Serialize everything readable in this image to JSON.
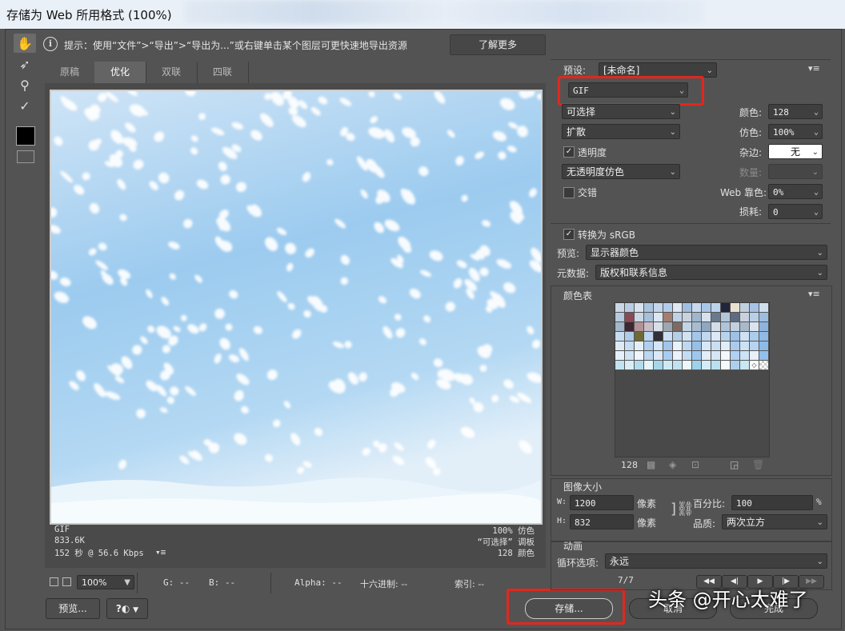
{
  "window": {
    "title": "存储为 Web 所用格式 (100%)"
  },
  "info": {
    "text": "提示：使用“文件”>“导出”>“导出为...”或右键单击某个图层可更快速地导出资源",
    "learn_more": "了解更多"
  },
  "tabs": [
    "原稿",
    "优化",
    "双联",
    "四联"
  ],
  "preview_info": {
    "format": "GIF",
    "size": "833.6K",
    "time": "152 秒 @ 56.6 Kbps",
    "dither": "100% 仿色",
    "palette": "“可选择” 调板",
    "colors": "128 颜色"
  },
  "status": {
    "zoom": "100%",
    "r": "G: --",
    "b": "B: --",
    "alpha": "Alpha: --",
    "hex": "十六进制: --",
    "index": "索引: --"
  },
  "buttons": {
    "preview": "预览...",
    "save": "存储...",
    "cancel": "取消",
    "done": "完成"
  },
  "settings": {
    "preset_label": "预设:",
    "preset_value": "[未命名]",
    "format": "GIF",
    "reduction": "可选择",
    "dither_algo": "扩散",
    "transparency_label": "透明度",
    "transparency_checked": true,
    "trans_dither": "无透明度仿色",
    "interlaced_label": "交错",
    "interlaced_checked": false,
    "colors_label": "颜色:",
    "colors_value": "128",
    "dither_label": "仿色:",
    "dither_value": "100%",
    "matte_label": "杂边:",
    "matte_value": "无",
    "amount_label": "数量:",
    "amount_value": "",
    "websnap_label": "Web 靠色:",
    "websnap_value": "0%",
    "lossy_label": "损耗:",
    "lossy_value": "0",
    "srgb_label": "转换为 sRGB",
    "srgb_checked": true,
    "preview_label": "预览:",
    "preview_value": "显示器颜色",
    "metadata_label": "元数据:",
    "metadata_value": "版权和联系信息"
  },
  "color_table": {
    "title": "颜色表",
    "count": "128",
    "colors": [
      "#c9d7e6",
      "#b9cde2",
      "#d9e3ee",
      "#aac4df",
      "#c3d6ec",
      "#b3ccea",
      "#dfe7f0",
      "#9fbfe2",
      "#c8d9ee",
      "#a9c7e8",
      "#bcd3ec",
      "#22253a",
      "#e8e1d2",
      "#c1d0e0",
      "#a6c3e4",
      "#d0deec",
      "#b7c9dc",
      "#8a4a55",
      "#cad7e4",
      "#a7bfd8",
      "#dce6f1",
      "#a47e70",
      "#bfd2e8",
      "#c9d3dd",
      "#9fb6cc",
      "#d6e1ed",
      "#697a8d",
      "#b3c7db",
      "#5f6b80",
      "#c7d2de",
      "#b9cfe8",
      "#9cbde0",
      "#a3b7cb",
      "#3b2832",
      "#b29296",
      "#c8bcc6",
      "#d7dfe9",
      "#9fa5b1",
      "#7e6a64",
      "#c4d4e5",
      "#a8bcd1",
      "#8fa7c0",
      "#d3dde8",
      "#b0c5da",
      "#c1cfde",
      "#aab9c9",
      "#d9e4ef",
      "#8eb4de",
      "#c8dcf1",
      "#aecce9",
      "#6f6a35",
      "#bcd5ee",
      "#322f38",
      "#cbdff3",
      "#b5cfe9",
      "#d1e2f3",
      "#a5c6e8",
      "#c0d7ef",
      "#dbe8f5",
      "#b8d3ee",
      "#9dc1e7",
      "#cfe1f4",
      "#acccec",
      "#90b9e4",
      "#ddeaf6",
      "#c6dcf2",
      "#e4eef8",
      "#b1cfed",
      "#d4e5f5",
      "#a2c5ea",
      "#e9f1f9",
      "#bfd7f0",
      "#98bfe8",
      "#d7e7f6",
      "#c9def3",
      "#e1ecf7",
      "#aacbed",
      "#cde1f4",
      "#b7d3ef",
      "#8dbbe9",
      "#e6f0fa",
      "#d0e3f5",
      "#f0f5fb",
      "#bad6f1",
      "#dae9f7",
      "#a9cdf0",
      "#eaf2fa",
      "#c4dcf3",
      "#9fc7ee",
      "#e2edf8",
      "#d5e6f6",
      "#f3f7fc",
      "#b0d1f1",
      "#cce2f5",
      "#e8f1fa",
      "#92c0ec",
      "#c2e4f1",
      "#d9eef6",
      "#b2dcee",
      "#e7f4f9",
      "#a6d6ec",
      "#cdeaf4",
      "#bfe3f2",
      "#eef7fb",
      "#9ed2ea",
      "#d3ecf5",
      "#b9e0f0",
      "#f5fafd",
      "#accfee",
      "#c8e6f3",
      "#e0f1f8",
      "#fbfdff"
    ]
  },
  "image_size": {
    "title": "图像大小",
    "w_label": "W:",
    "w_value": "1200",
    "h_label": "H:",
    "h_value": "832",
    "unit": "像素",
    "percent_label": "百分比:",
    "percent_value": "100",
    "percent_unit": "%",
    "quality_label": "品质:",
    "quality_value": "两次立方"
  },
  "animation": {
    "title": "动画",
    "loop_label": "循环选项:",
    "loop_value": "永远",
    "frame": "7/7"
  },
  "watermark": "头条 @开心太难了"
}
